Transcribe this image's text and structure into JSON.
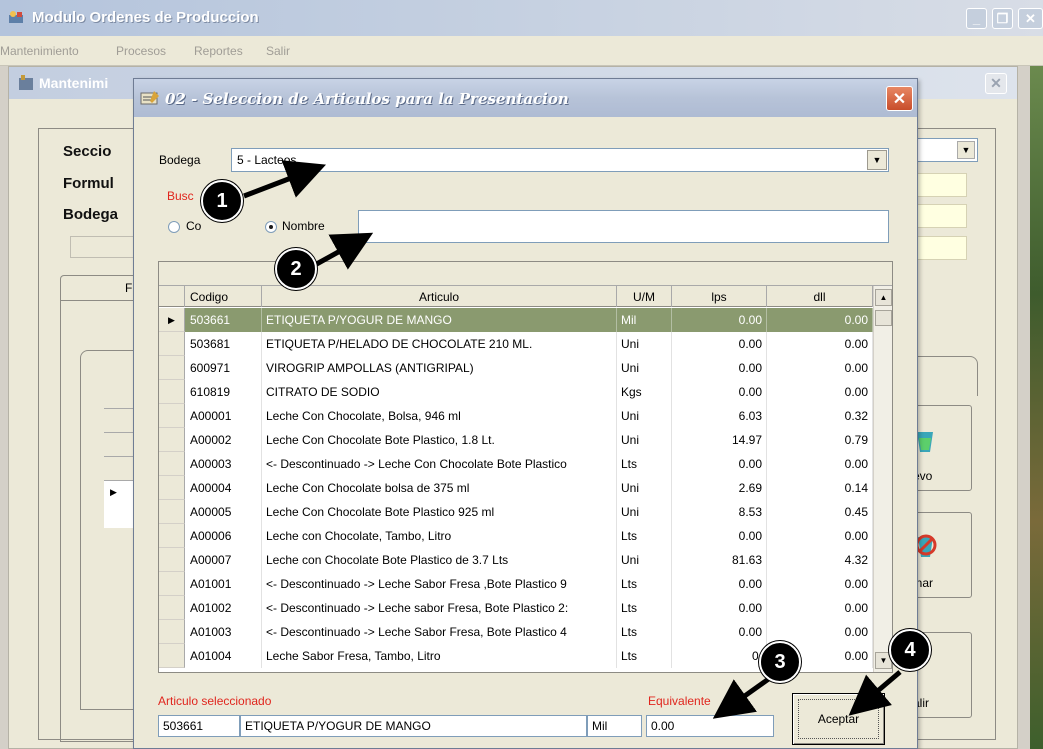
{
  "main_window": {
    "title": "Modulo Ordenes de Produccion",
    "menu": [
      "Mantenimiento",
      "Procesos",
      "Reportes",
      "Salir"
    ]
  },
  "child_window": {
    "title": "Mantenimi",
    "labels": [
      "Seccio",
      "Formul",
      "Bodega"
    ],
    "tab_label": "F",
    "button_labels": [
      "evo",
      "inar",
      "alir"
    ]
  },
  "dialog": {
    "title": "02 - Seleccion de Articulos para la Presentacion",
    "bodega_label": "Bodega",
    "bodega_value": "5 - Lacteos",
    "buscar_label": "Busc",
    "radio_codigo_label": "Co",
    "radio_nombre_label": "Nombre",
    "search_value": "",
    "columns": [
      "Codigo",
      "Articulo",
      "U/M",
      "lps",
      "dll"
    ],
    "rows": [
      {
        "codigo": "503661",
        "articulo": "ETIQUETA P/YOGUR DE MANGO",
        "um": "Mil",
        "lps": "0.00",
        "dll": "0.00"
      },
      {
        "codigo": "503681",
        "articulo": "ETIQUETA P/HELADO DE CHOCOLATE 210 ML.",
        "um": "Uni",
        "lps": "0.00",
        "dll": "0.00"
      },
      {
        "codigo": "600971",
        "articulo": "VIROGRIP AMPOLLAS (ANTIGRIPAL)",
        "um": "Uni",
        "lps": "0.00",
        "dll": "0.00"
      },
      {
        "codigo": "610819",
        "articulo": "CITRATO DE SODIO",
        "um": "Kgs",
        "lps": "0.00",
        "dll": "0.00"
      },
      {
        "codigo": "A00001",
        "articulo": "Leche Con Chocolate, Bolsa, 946 ml",
        "um": "Uni",
        "lps": "6.03",
        "dll": "0.32"
      },
      {
        "codigo": "A00002",
        "articulo": "Leche Con Chocolate Bote Plastico, 1.8 Lt.",
        "um": "Uni",
        "lps": "14.97",
        "dll": "0.79"
      },
      {
        "codigo": "A00003",
        "articulo": "<- Descontinuado -> Leche Con Chocolate Bote Plastico",
        "um": "Lts",
        "lps": "0.00",
        "dll": "0.00"
      },
      {
        "codigo": "A00004",
        "articulo": "Leche Con Chocolate bolsa de 375 ml",
        "um": "Uni",
        "lps": "2.69",
        "dll": "0.14"
      },
      {
        "codigo": "A00005",
        "articulo": "Leche Con Chocolate Bote Plastico 925 ml",
        "um": "Uni",
        "lps": "8.53",
        "dll": "0.45"
      },
      {
        "codigo": "A00006",
        "articulo": "Leche con Chocolate, Tambo, Litro",
        "um": "Lts",
        "lps": "0.00",
        "dll": "0.00"
      },
      {
        "codigo": "A00007",
        "articulo": "Leche con Chocolate Bote Plastico de 3.7 Lts",
        "um": "Uni",
        "lps": "81.63",
        "dll": "4.32"
      },
      {
        "codigo": "A01001",
        "articulo": "<- Descontinuado -> Leche Sabor Fresa ,Bote Plastico 9",
        "um": "Lts",
        "lps": "0.00",
        "dll": "0.00"
      },
      {
        "codigo": "A01002",
        "articulo": "<- Descontinuado -> Leche sabor Fresa, Bote Plastico 2:",
        "um": "Lts",
        "lps": "0.00",
        "dll": "0.00"
      },
      {
        "codigo": "A01003",
        "articulo": "<- Descontinuado -> Leche Sabor Fresa, Bote Plastico 4",
        "um": "Lts",
        "lps": "0.00",
        "dll": "0.00"
      },
      {
        "codigo": "A01004",
        "articulo": "Leche Sabor Fresa, Tambo, Litro",
        "um": "Lts",
        "lps": "0.",
        "dll": "0.00"
      }
    ],
    "selected_label": "Articulo seleccionado",
    "selected_codigo": "503661",
    "selected_articulo": "ETIQUETA P/YOGUR DE MANGO",
    "selected_um": "Mil",
    "equivalente_label": "Equivalente",
    "equivalente_value": "0.00",
    "accept_label": "Aceptar"
  },
  "annotations": [
    "1",
    "2",
    "3",
    "4"
  ]
}
